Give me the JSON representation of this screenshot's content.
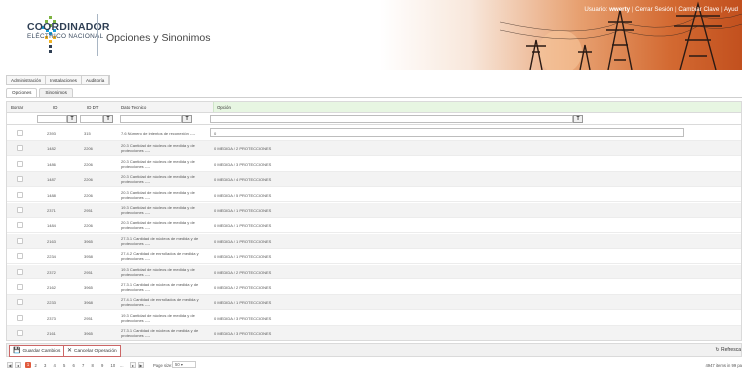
{
  "header": {
    "logo_line1": "COORDINADOR",
    "logo_line2": "ELÉCTRICO NACIONAL",
    "title": "Opciones y Sinonimos",
    "links": {
      "usuario_label": "Usuario:",
      "usuario_name": "wwerty",
      "cerrar": "Cerrar Sesión",
      "cambiar": "Cambiar Clave",
      "ayuda": "Ayud"
    }
  },
  "menu": [
    "Administración",
    "Instalaciones",
    "Auditoría"
  ],
  "tabs": [
    "Opciones",
    "Sinonimos"
  ],
  "grid": {
    "headers": {
      "borrar": "Borrar",
      "id": "ID",
      "id_dt": "ID DT",
      "dato_tecnico": "Dato Tecnico",
      "opcion": "Opción"
    },
    "filter_icon": "filter-icon",
    "rows": [
      {
        "id": "2393",
        "iddt": "315",
        "dato": "7.6 Número de intentos de reconexión ----",
        "opcion": "0"
      },
      {
        "id": "1482",
        "iddt": "2206",
        "dato": "20.3 Cantidad de núcleos de medida y de protecciones ----",
        "opcion": "0 MEDIDA / 2 PROTECCIONES"
      },
      {
        "id": "1486",
        "iddt": "2206",
        "dato": "20.3 Cantidad de núcleos de medida y de protecciones ----",
        "opcion": "0 MEDIDA / 3 PROTECCIONES"
      },
      {
        "id": "1487",
        "iddt": "2206",
        "dato": "20.3 Cantidad de núcleos de medida y de protecciones ----",
        "opcion": "0 MEDIDA / 4 PROTECCIONES"
      },
      {
        "id": "1488",
        "iddt": "2206",
        "dato": "20.3 Cantidad de núcleos de medida y de protecciones ----",
        "opcion": "0 MEDIDA / 5 PROTECCIONES"
      },
      {
        "id": "2371",
        "iddt": "2951",
        "dato": "19.3 Cantidad de núcleos de medida y de protecciones ----",
        "opcion": "0 MEDIDA / 1 PROTECCIONES"
      },
      {
        "id": "1484",
        "iddt": "2206",
        "dato": "20.3 Cantidad de núcleos de medida y de protecciones ----",
        "opcion": "0 MEDIDA / 1 PROTECCIONES"
      },
      {
        "id": "2163",
        "iddt": "3965",
        "dato": "27.3.1 Cantidad de núcleos de medida y de protecciones ----",
        "opcion": "0 MEDIDA / 1 PROTECCIONES"
      },
      {
        "id": "2234",
        "iddt": "3958",
        "dato": "27.4.2 Cantidad de enrrollados de medida y protecciones ----",
        "opcion": "0 MEDIDA / 1 PROTECCIONES"
      },
      {
        "id": "2372",
        "iddt": "2951",
        "dato": "19.3 Cantidad de núcleos de medida y de protecciones ----",
        "opcion": "0 MEDIDA / 2 PROTECCIONES"
      },
      {
        "id": "2162",
        "iddt": "3965",
        "dato": "27.3.1 Cantidad de núcleos de medida y de protecciones ----",
        "opcion": "0 MEDIDA / 2 PROTECCIONES"
      },
      {
        "id": "2233",
        "iddt": "3968",
        "dato": "27.4.1 Cantidad de enrrollados de medida y protecciones ----",
        "opcion": "0 MEDIDA / 1 PROTECCIONES"
      },
      {
        "id": "2373",
        "iddt": "2951",
        "dato": "19.3 Cantidad de núcleos de medida y de protecciones ----",
        "opcion": "0 MEDIDA / 3 PROTECCIONES"
      },
      {
        "id": "2161",
        "iddt": "3965",
        "dato": "27.3.1 Cantidad de núcleos de medida y de protecciones ----",
        "opcion": "0 MEDIDA / 3 PROTECCIONES"
      }
    ]
  },
  "toolbar": {
    "save": "Guardar Cambios",
    "cancel": "Cancelar Operación",
    "refresh": "Refresca"
  },
  "pager": {
    "pages": [
      "1",
      "2",
      "3",
      "4",
      "5",
      "6",
      "7",
      "8",
      "9",
      "10",
      "..."
    ],
    "current": "1",
    "page_size_label": "Page size:",
    "page_size": "50",
    "total": "4947 items in 99 pa"
  }
}
